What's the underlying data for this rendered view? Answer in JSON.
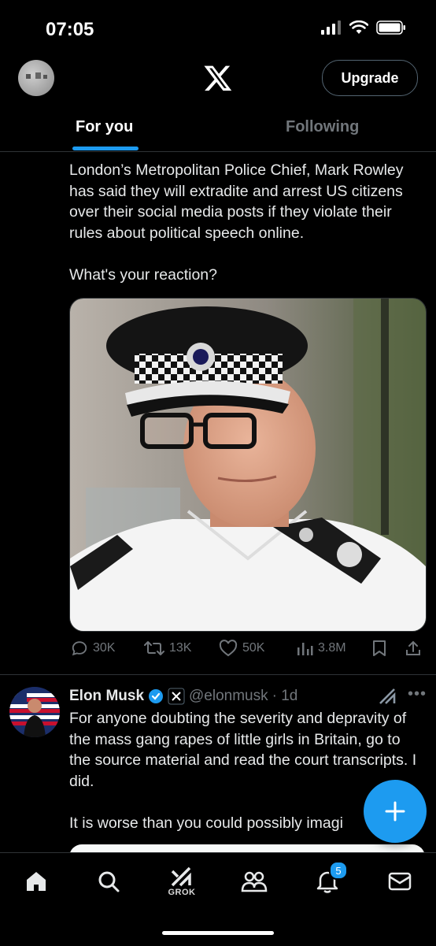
{
  "status": {
    "time": "07:05"
  },
  "header": {
    "upgrade_label": "Upgrade"
  },
  "tabs": [
    {
      "label": "For you"
    },
    {
      "label": "Following"
    }
  ],
  "post1": {
    "text": "London’s Metropolitan Police Chief, Mark Rowley has said they will extradite and arrest US citizens over their social media posts if they violate their rules about political speech online.\n\nWhat's your reaction?",
    "stats": {
      "replies": "30K",
      "reposts": "13K",
      "likes": "50K",
      "views": "3.8M"
    }
  },
  "post2": {
    "name": "Elon Musk",
    "handle": "@elonmusk",
    "time": "· 1d",
    "text": "For anyone doubting the severity and depravity of the mass gang rapes of little girls in Britain, go to the source material and read the court transcripts. I did.\n\nIt is worse than you could possibly imagi"
  },
  "nav": {
    "grok_label": "GROK",
    "notifications_badge": "5"
  },
  "colors": {
    "accent": "#1d9bf0",
    "muted": "#71767b",
    "border": "#2f3336"
  }
}
